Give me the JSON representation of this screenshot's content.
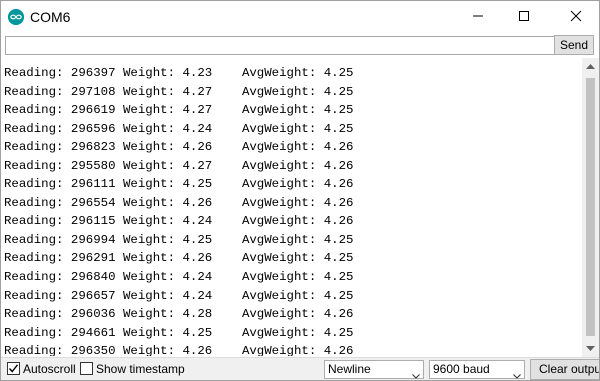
{
  "window": {
    "title": "COM6"
  },
  "input": {
    "value": "",
    "send_label": "Send"
  },
  "output": {
    "lines": [
      "Reading: 296397 Weight: 4.23    AvgWeight: 4.25",
      "Reading: 297108 Weight: 4.27    AvgWeight: 4.25",
      "Reading: 296619 Weight: 4.27    AvgWeight: 4.25",
      "Reading: 296596 Weight: 4.24    AvgWeight: 4.25",
      "Reading: 296823 Weight: 4.26    AvgWeight: 4.26",
      "Reading: 295580 Weight: 4.27    AvgWeight: 4.26",
      "Reading: 296111 Weight: 4.25    AvgWeight: 4.26",
      "Reading: 296554 Weight: 4.26    AvgWeight: 4.26",
      "Reading: 296115 Weight: 4.24    AvgWeight: 4.26",
      "Reading: 296994 Weight: 4.25    AvgWeight: 4.25",
      "Reading: 296291 Weight: 4.26    AvgWeight: 4.25",
      "Reading: 296840 Weight: 4.24    AvgWeight: 4.25",
      "Reading: 296657 Weight: 4.24    AvgWeight: 4.25",
      "Reading: 296036 Weight: 4.28    AvgWeight: 4.26",
      "Reading: 294661 Weight: 4.25    AvgWeight: 4.25",
      "Reading: 296350 Weight: 4.26    AvgWeight: 4.26"
    ]
  },
  "statusbar": {
    "autoscroll_label": "Autoscroll",
    "autoscroll_checked": true,
    "timestamp_label": "Show timestamp",
    "timestamp_checked": false,
    "line_ending": "Newline",
    "baud_rate": "9600 baud",
    "clear_label": "Clear output"
  },
  "icons": {
    "app": "arduino-logo-icon",
    "minimize": "minimize-icon",
    "maximize": "maximize-icon",
    "close": "close-icon"
  },
  "colors": {
    "accent": "#00979d"
  }
}
